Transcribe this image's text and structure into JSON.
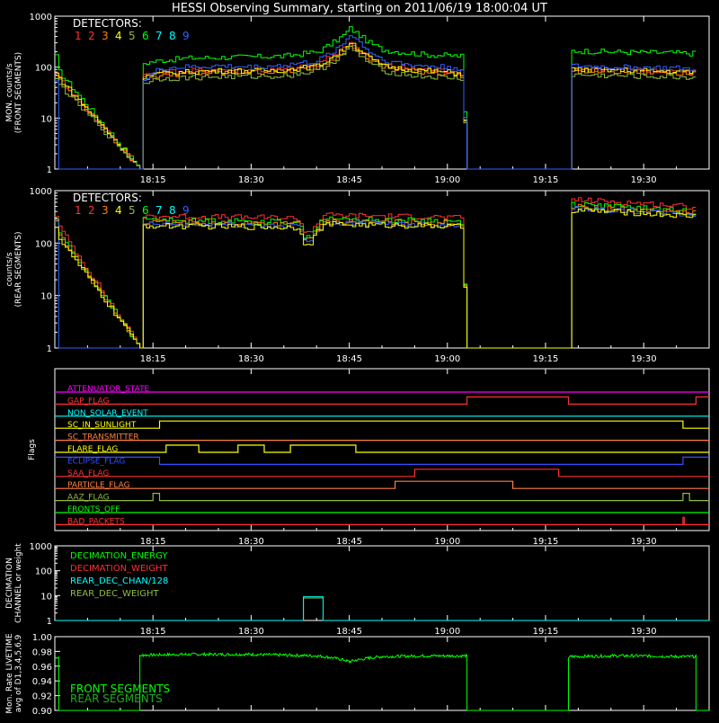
{
  "title": "HESSI Observing Summary, starting on 2011/06/19 18:00:04 UT",
  "colors": {
    "d1": "#ff3030",
    "d2": "#ff3030",
    "d3": "#ff8000",
    "d4": "#ffff00",
    "d5": "#8fbc3f",
    "d6": "#00ff00",
    "d7": "#00ffff",
    "d8": "#00ffff",
    "d9": "#3060ff",
    "axis": "#ffffff",
    "background": "#000000"
  },
  "x_axis": {
    "start_minutes": 0,
    "end_minutes": 100,
    "ticks": [
      {
        "t": 15,
        "label": "18:15"
      },
      {
        "t": 30,
        "label": "18:30"
      },
      {
        "t": 45,
        "label": "18:45"
      },
      {
        "t": 60,
        "label": "19:00"
      },
      {
        "t": 75,
        "label": "19:15"
      },
      {
        "t": 90,
        "label": "19:30"
      }
    ]
  },
  "chart_data": [
    {
      "type": "line",
      "id": "front",
      "ylabel": "MON. counts/s\n(FRONT SEGMENTS)",
      "yscale": "log",
      "ylim": [
        1,
        1000
      ],
      "yticks": [
        {
          "v": 1,
          "label": "1"
        },
        {
          "v": 10,
          "label": "10"
        },
        {
          "v": 100,
          "label": "100"
        },
        {
          "v": 1000,
          "label": "1000"
        }
      ],
      "legend_title": "DETECTORS:",
      "legend_items": [
        "1",
        "2",
        "3",
        "4",
        "5",
        "6",
        "7",
        "8",
        "9"
      ],
      "data_gaps": [
        [
          0,
          0.8
        ],
        [
          13,
          15
        ],
        [
          63,
          78.5
        ],
        [
          98,
          100
        ]
      ],
      "series": [
        {
          "color": "d6",
          "x": [
            0,
            0.6,
            13,
            13.5,
            16,
            20,
            25,
            30,
            35,
            40,
            42,
            44,
            45,
            46,
            48,
            50,
            54,
            57,
            60,
            62,
            63,
            78.5,
            79,
            85,
            90,
            95,
            98
          ],
          "y": [
            160,
            80,
            1,
            120,
            135,
            150,
            155,
            160,
            165,
            200,
            280,
            420,
            580,
            470,
            300,
            220,
            190,
            175,
            170,
            165,
            1,
            1,
            210,
            200,
            195,
            190,
            185
          ]
        },
        {
          "color": "d1",
          "x": [
            0,
            0.6,
            13,
            13.5,
            16,
            20,
            25,
            30,
            35,
            40,
            42,
            44,
            45,
            46,
            48,
            50,
            54,
            57,
            60,
            62,
            63,
            78.5,
            79,
            85,
            90,
            95,
            98
          ],
          "y": [
            85,
            60,
            1,
            70,
            80,
            85,
            90,
            88,
            90,
            110,
            160,
            230,
            300,
            240,
            150,
            110,
            95,
            90,
            85,
            80,
            1,
            1,
            95,
            90,
            88,
            85,
            80
          ]
        },
        {
          "color": "d3",
          "x": [
            0,
            0.6,
            13,
            13.5,
            16,
            20,
            25,
            30,
            35,
            40,
            42,
            44,
            45,
            46,
            48,
            50,
            54,
            57,
            60,
            62,
            63,
            78.5,
            79,
            85,
            90,
            95,
            98
          ],
          "y": [
            70,
            55,
            1,
            60,
            70,
            75,
            78,
            80,
            82,
            100,
            140,
            210,
            270,
            220,
            140,
            100,
            85,
            80,
            75,
            70,
            1,
            1,
            85,
            82,
            80,
            78,
            75
          ]
        },
        {
          "color": "d4",
          "x": [
            0,
            0.6,
            13,
            13.5,
            16,
            20,
            25,
            30,
            35,
            40,
            42,
            44,
            45,
            46,
            48,
            50,
            54,
            57,
            60,
            62,
            63,
            78.5,
            79,
            85,
            90,
            95,
            98
          ],
          "y": [
            75,
            60,
            1,
            65,
            75,
            80,
            85,
            85,
            88,
            105,
            150,
            220,
            320,
            250,
            150,
            105,
            90,
            85,
            80,
            75,
            1,
            1,
            90,
            88,
            85,
            82,
            80
          ]
        },
        {
          "color": "d5",
          "x": [
            0,
            0.6,
            13,
            13.5,
            16,
            20,
            25,
            30,
            35,
            40,
            42,
            44,
            45,
            46,
            48,
            50,
            54,
            57,
            60,
            62,
            63,
            78.5,
            79,
            85,
            90,
            95,
            98
          ],
          "y": [
            55,
            45,
            1,
            50,
            60,
            62,
            65,
            66,
            68,
            85,
            120,
            180,
            240,
            190,
            120,
            85,
            70,
            65,
            62,
            60,
            1,
            1,
            70,
            68,
            66,
            64,
            62
          ]
        },
        {
          "color": "d9",
          "x": [
            0,
            0.6,
            13,
            13.5,
            16,
            20,
            25,
            30,
            35,
            40,
            42,
            44,
            45,
            46,
            48,
            50,
            54,
            57,
            60,
            62,
            63,
            78.5,
            79,
            85,
            90,
            95,
            98
          ],
          "y": [
            60,
            1,
            1,
            55,
            95,
            100,
            105,
            100,
            110,
            130,
            190,
            290,
            450,
            350,
            200,
            140,
            110,
            105,
            100,
            95,
            1,
            1,
            105,
            100,
            98,
            95,
            90
          ]
        }
      ]
    },
    {
      "type": "line",
      "id": "rear",
      "ylabel": "counts/s\n(REAR SEGMENTS)",
      "yscale": "log",
      "ylim": [
        1,
        1000
      ],
      "yticks": [
        {
          "v": 1,
          "label": "1"
        },
        {
          "v": 10,
          "label": "10"
        },
        {
          "v": 100,
          "label": "100"
        },
        {
          "v": 1000,
          "label": "1000"
        }
      ],
      "legend_title": "DETECTORS:",
      "legend_items": [
        "1",
        "2",
        "3",
        "4",
        "5",
        "6",
        "7",
        "8",
        "9"
      ],
      "series": [
        {
          "color": "d1",
          "x": [
            0,
            0.6,
            13,
            13.5,
            20,
            30,
            37,
            38,
            39,
            40,
            41,
            42,
            50,
            57,
            60,
            62,
            63,
            78.5,
            79,
            85,
            90,
            95,
            98
          ],
          "y": [
            350,
            200,
            1,
            330,
            320,
            310,
            300,
            170,
            170,
            250,
            340,
            340,
            330,
            320,
            310,
            300,
            1,
            1,
            680,
            620,
            570,
            520,
            480
          ]
        },
        {
          "color": "d6",
          "x": [
            0,
            0.6,
            13,
            13.5,
            20,
            30,
            37,
            38,
            39,
            40,
            41,
            42,
            50,
            57,
            60,
            62,
            63,
            78.5,
            79,
            85,
            90,
            95,
            98
          ],
          "y": [
            290,
            150,
            1,
            280,
            270,
            260,
            255,
            140,
            140,
            210,
            280,
            285,
            275,
            270,
            260,
            255,
            1,
            1,
            560,
            500,
            460,
            420,
            400
          ]
        },
        {
          "color": "d3",
          "x": [
            0,
            0.6,
            13,
            13.5,
            20,
            30,
            37,
            38,
            39,
            40,
            41,
            42,
            50,
            57,
            60,
            62,
            63,
            78.5,
            79,
            85,
            90,
            95,
            98
          ],
          "y": [
            260,
            140,
            1,
            250,
            245,
            240,
            235,
            120,
            120,
            190,
            255,
            260,
            250,
            245,
            240,
            235,
            1,
            1,
            500,
            450,
            420,
            390,
            370
          ]
        },
        {
          "color": "d9",
          "x": [
            0,
            0.6,
            13,
            13.5,
            20,
            30,
            37,
            38,
            39,
            40,
            41,
            42,
            50,
            57,
            60,
            62,
            63,
            78.5,
            79,
            85,
            90,
            95,
            98
          ],
          "y": [
            240,
            1,
            1,
            230,
            225,
            220,
            215,
            110,
            110,
            180,
            240,
            245,
            235,
            230,
            225,
            220,
            1,
            1,
            460,
            420,
            390,
            360,
            340
          ]
        },
        {
          "color": "d4",
          "x": [
            0,
            0.6,
            13,
            13.5,
            20,
            30,
            37,
            38,
            39,
            40,
            41,
            42,
            50,
            57,
            60,
            62,
            63,
            78.5,
            79,
            85,
            90,
            95,
            98
          ],
          "y": [
            220,
            120,
            1,
            215,
            210,
            205,
            200,
            105,
            105,
            170,
            225,
            230,
            220,
            215,
            210,
            205,
            1,
            1,
            430,
            400,
            370,
            340,
            320
          ]
        }
      ]
    },
    {
      "type": "line",
      "id": "flags",
      "ylabel": "Flags",
      "rows": [
        {
          "label": "ATTENUATOR_STATE",
          "color": "#ff00ff",
          "x": [
            0,
            100
          ],
          "y": [
            0,
            0
          ]
        },
        {
          "label": "GAP_FLAG",
          "color": "#ff3030",
          "x": [
            0,
            63,
            63,
            78.5,
            78.5,
            98,
            98,
            100
          ],
          "y": [
            0,
            0,
            1,
            1,
            0,
            0,
            1,
            1
          ]
        },
        {
          "label": "NON_SOLAR_EVENT",
          "color": "#00ffff",
          "x": [
            0,
            100
          ],
          "y": [
            0,
            0
          ]
        },
        {
          "label": "SC_IN_SUNLIGHT",
          "color": "#ffff00",
          "x": [
            0,
            16,
            16,
            96,
            96,
            100
          ],
          "y": [
            0,
            0,
            1,
            1,
            0,
            0
          ]
        },
        {
          "label": "SC_TRANSMITTER",
          "color": "#ff8040",
          "x": [
            0,
            100
          ],
          "y": [
            0,
            0
          ]
        },
        {
          "label": "FLARE_FLAG",
          "color": "#ffff00",
          "x": [
            0,
            17,
            17,
            22,
            22,
            28,
            28,
            32,
            32,
            36,
            36,
            46,
            46,
            100
          ],
          "y": [
            0,
            0,
            1,
            1,
            0,
            0,
            1,
            1,
            0,
            0,
            1,
            1,
            0,
            0
          ]
        },
        {
          "label": "ECLIPSE_FLAG",
          "color": "#3050ff",
          "x": [
            0,
            16,
            16,
            96,
            96,
            100
          ],
          "y": [
            1,
            1,
            0,
            0,
            1,
            1
          ]
        },
        {
          "label": "SAA_FLAG",
          "color": "#ff3030",
          "x": [
            0,
            55,
            55,
            77,
            77,
            100
          ],
          "y": [
            0,
            0,
            1,
            1,
            0,
            0
          ]
        },
        {
          "label": "PARTICLE_FLAG",
          "color": "#ff8040",
          "x": [
            0,
            52,
            52,
            70,
            70,
            100
          ],
          "y": [
            0,
            0,
            1,
            1,
            0,
            0
          ]
        },
        {
          "label": "AAZ_FLAG",
          "color": "#8fbc3f",
          "x": [
            0,
            15,
            15,
            16,
            16,
            96,
            96,
            97,
            97,
            100
          ],
          "y": [
            0,
            0,
            1,
            1,
            0,
            0,
            1,
            1,
            0,
            0
          ]
        },
        {
          "label": "FRONTS_OFF",
          "color": "#00ff00",
          "x": [
            0,
            100
          ],
          "y": [
            0,
            0
          ]
        },
        {
          "label": "BAD_PACKETS",
          "color": "#ff3030",
          "x": [
            0,
            96,
            96,
            96.2,
            96.2,
            100
          ],
          "y": [
            0,
            0,
            1,
            1,
            0,
            0
          ]
        }
      ]
    },
    {
      "type": "line",
      "id": "decimation",
      "ylabel": "DECIMATION\nCHANNEL or weight",
      "yscale": "log",
      "ylim": [
        1,
        1000
      ],
      "yticks": [
        {
          "v": 1,
          "label": "1"
        },
        {
          "v": 10,
          "label": "10"
        },
        {
          "v": 100,
          "label": "100"
        },
        {
          "v": 1000,
          "label": "1000"
        }
      ],
      "legend_items": [
        {
          "label": "DECIMATION_ENERGY",
          "color": "#00ff00"
        },
        {
          "label": "DECIMATION_WEIGHT",
          "color": "#ff3030"
        },
        {
          "label": "REAR_DEC_CHAN/128",
          "color": "#00ffff"
        },
        {
          "label": "REAR_DEC_WEIGHT",
          "color": "#8fbc3f"
        }
      ],
      "series": [
        {
          "color": "#8fbc3f",
          "x": [
            0,
            38,
            38,
            41,
            41,
            100
          ],
          "y": [
            1,
            1,
            8,
            8,
            1,
            1
          ]
        },
        {
          "color": "#00ffff",
          "x": [
            0,
            38,
            38,
            41,
            41,
            100
          ],
          "y": [
            1,
            1,
            9,
            9,
            1,
            1
          ]
        }
      ]
    },
    {
      "type": "line",
      "id": "livetime",
      "ylabel": "Mon. Rate LIVETIME\navg of D1,3,4,5,6,9",
      "ylim": [
        0.9,
        1.0
      ],
      "yticks": [
        {
          "v": 0.9,
          "label": "0.90"
        },
        {
          "v": 0.92,
          "label": "0.92"
        },
        {
          "v": 0.94,
          "label": "0.94"
        },
        {
          "v": 0.96,
          "label": "0.96"
        },
        {
          "v": 0.98,
          "label": "0.98"
        },
        {
          "v": 1.0,
          "label": "1.00"
        }
      ],
      "legend_items": [
        {
          "label": "FRONT SEGMENTS",
          "color": "#00ff00"
        },
        {
          "label": "REAR SEGMENTS",
          "color": "#22aa22"
        }
      ],
      "series": [
        {
          "color": "#00ff00",
          "x": [
            0,
            0.6,
            0.6,
            13,
            13,
            13.5,
            20,
            30,
            35,
            40,
            42,
            44,
            45,
            46,
            48,
            50,
            57,
            62,
            63,
            63,
            78.5,
            78.5,
            79,
            85,
            90,
            95,
            98,
            98,
            100
          ],
          "y": [
            0.972,
            0.972,
            0.9,
            0.9,
            0.974,
            0.975,
            0.976,
            0.976,
            0.975,
            0.974,
            0.972,
            0.969,
            0.966,
            0.968,
            0.971,
            0.973,
            0.974,
            0.974,
            0.974,
            0.9,
            0.9,
            0.972,
            0.973,
            0.974,
            0.974,
            0.973,
            0.973,
            0.9,
            0.9
          ]
        }
      ]
    }
  ]
}
